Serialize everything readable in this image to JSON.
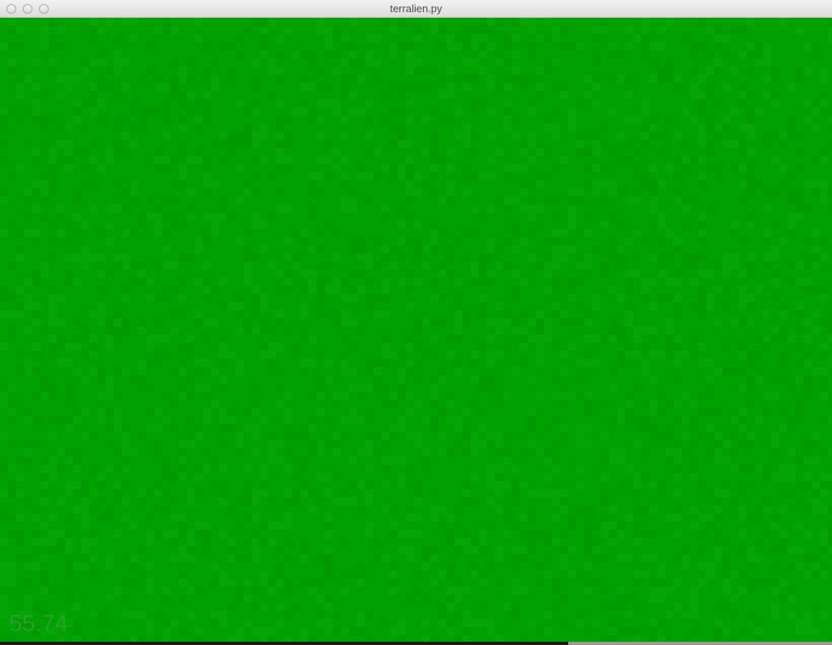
{
  "window": {
    "title": "terralien.py"
  },
  "titlebar": {
    "buttons": [
      {
        "name": "close",
        "icon": "close-circle-icon"
      },
      {
        "name": "minimize",
        "icon": "minimize-circle-icon"
      },
      {
        "name": "zoom",
        "icon": "zoom-circle-icon"
      }
    ]
  },
  "game": {
    "ground_color": "#00a000",
    "ground_tint_dark": "#009a00",
    "ground_tint_light": "#04a504",
    "fps": "55.74"
  }
}
